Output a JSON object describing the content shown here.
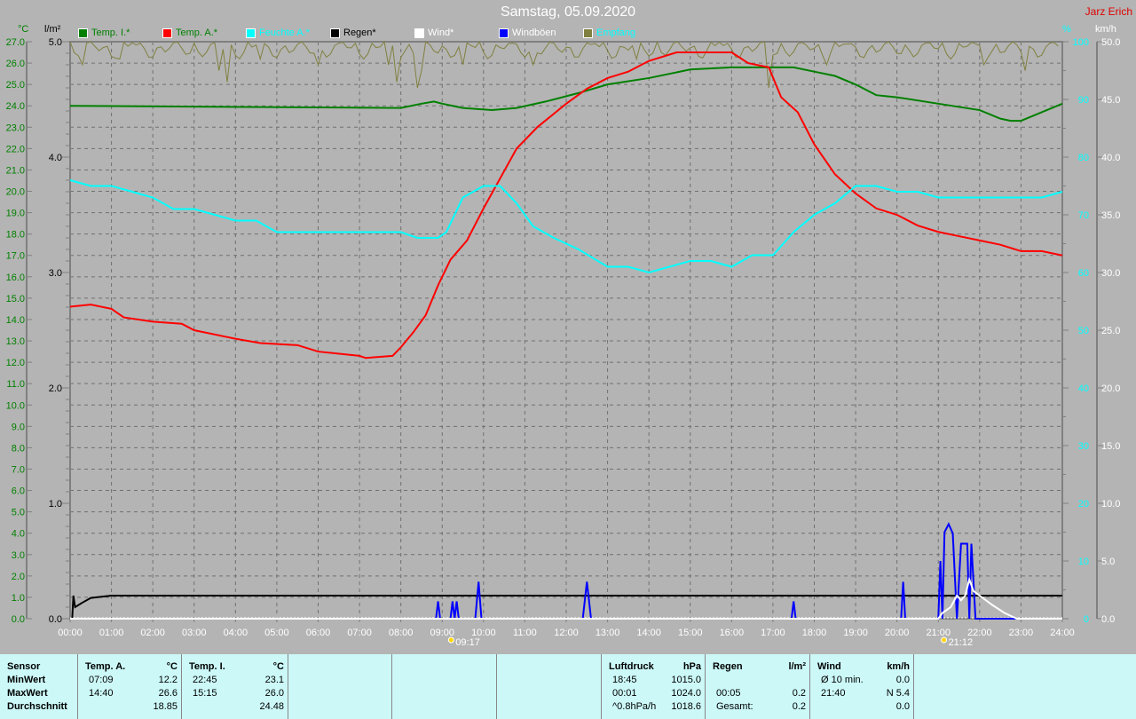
{
  "title": "Samstag, 05.09.2020",
  "author": "Jarz Erich",
  "units": {
    "temp": "°C",
    "rain": "l/m²",
    "hum": "%",
    "wind": "km/h"
  },
  "legend": [
    {
      "label": "Temp. I.*",
      "color": "#008000",
      "text_color": "#008000"
    },
    {
      "label": "Temp. A.*",
      "color": "#ff0000",
      "text_color": "#008000"
    },
    {
      "label": "Feuchte A.*",
      "color": "#00ffff",
      "text_color": "#00ffff"
    },
    {
      "label": "Regen*",
      "color": "#000000",
      "text_color": "#000000"
    },
    {
      "label": "Wind*",
      "color": "#ffffff",
      "text_color": "#ffffff"
    },
    {
      "label": "Windböen",
      "color": "#0000ff",
      "text_color": "#ffffff"
    },
    {
      "label": "Empfang",
      "color": "#808040",
      "text_color": "#00ffff"
    }
  ],
  "chart_data": {
    "type": "line",
    "title": "Samstag, 05.09.2020",
    "x_ticks": [
      "00:00",
      "01:00",
      "02:00",
      "03:00",
      "04:00",
      "05:00",
      "06:00",
      "07:00",
      "08:00",
      "09:00",
      "10:00",
      "11:00",
      "12:00",
      "13:00",
      "14:00",
      "15:00",
      "16:00",
      "17:00",
      "18:00",
      "19:00",
      "20:00",
      "21:00",
      "22:00",
      "23:00",
      "24:00"
    ],
    "xlim": [
      0,
      24
    ],
    "axes": {
      "temp": [
        0,
        27
      ],
      "rain": [
        0,
        5
      ],
      "hum": [
        0,
        100
      ],
      "wind": [
        0,
        50
      ]
    },
    "markers": [
      {
        "time": 9.28,
        "label": "09:17"
      },
      {
        "time": 21.2,
        "label": "21:12"
      }
    ],
    "series": [
      {
        "name": "Temp. I.*",
        "axis": "temp",
        "color": "#008000",
        "points": [
          [
            0,
            24.0
          ],
          [
            8,
            23.9
          ],
          [
            8.5,
            24.1
          ],
          [
            8.8,
            24.2
          ],
          [
            9,
            24.1
          ],
          [
            9.5,
            23.9
          ],
          [
            10.2,
            23.8
          ],
          [
            10.8,
            23.9
          ],
          [
            11.5,
            24.2
          ],
          [
            12.3,
            24.6
          ],
          [
            13,
            25.0
          ],
          [
            14,
            25.3
          ],
          [
            15,
            25.7
          ],
          [
            16,
            25.8
          ],
          [
            17,
            25.8
          ],
          [
            17.5,
            25.8
          ],
          [
            18,
            25.6
          ],
          [
            18.5,
            25.4
          ],
          [
            19,
            25.0
          ],
          [
            19.5,
            24.5
          ],
          [
            20,
            24.4
          ],
          [
            21,
            24.1
          ],
          [
            22,
            23.8
          ],
          [
            22.5,
            23.4
          ],
          [
            22.75,
            23.3
          ],
          [
            23,
            23.3
          ],
          [
            23.5,
            23.7
          ],
          [
            24,
            24.1
          ]
        ]
      },
      {
        "name": "Temp. A.*",
        "axis": "temp",
        "color": "#ff0000",
        "points": [
          [
            0,
            14.6
          ],
          [
            0.5,
            14.7
          ],
          [
            1,
            14.5
          ],
          [
            1.3,
            14.1
          ],
          [
            2,
            13.9
          ],
          [
            2.7,
            13.8
          ],
          [
            3,
            13.5
          ],
          [
            4,
            13.1
          ],
          [
            4.6,
            12.9
          ],
          [
            5.5,
            12.8
          ],
          [
            6,
            12.5
          ],
          [
            7,
            12.3
          ],
          [
            7.15,
            12.2
          ],
          [
            7.8,
            12.3
          ],
          [
            8,
            12.7
          ],
          [
            8.3,
            13.4
          ],
          [
            8.6,
            14.2
          ],
          [
            8.9,
            15.6
          ],
          [
            9.2,
            16.8
          ],
          [
            9.6,
            17.7
          ],
          [
            10,
            19.2
          ],
          [
            10.4,
            20.6
          ],
          [
            10.8,
            22.0
          ],
          [
            11.3,
            23.0
          ],
          [
            12,
            24.1
          ],
          [
            12.5,
            24.8
          ],
          [
            13,
            25.3
          ],
          [
            13.5,
            25.6
          ],
          [
            14,
            26.1
          ],
          [
            14.67,
            26.5
          ],
          [
            15.5,
            26.5
          ],
          [
            16,
            26.5
          ],
          [
            16.4,
            26.0
          ],
          [
            16.9,
            25.8
          ],
          [
            17.2,
            24.4
          ],
          [
            17.6,
            23.7
          ],
          [
            18,
            22.2
          ],
          [
            18.5,
            20.8
          ],
          [
            19,
            19.9
          ],
          [
            19.5,
            19.2
          ],
          [
            20,
            18.9
          ],
          [
            20.5,
            18.4
          ],
          [
            21,
            18.1
          ],
          [
            21.5,
            17.9
          ],
          [
            22,
            17.7
          ],
          [
            22.5,
            17.5
          ],
          [
            23,
            17.2
          ],
          [
            23.5,
            17.2
          ],
          [
            24,
            17.0
          ]
        ]
      },
      {
        "name": "Feuchte A.*",
        "axis": "hum",
        "color": "#00ffff",
        "points": [
          [
            0,
            76
          ],
          [
            0.5,
            75
          ],
          [
            1,
            75
          ],
          [
            1.5,
            74
          ],
          [
            2,
            73
          ],
          [
            2.5,
            71
          ],
          [
            3,
            71
          ],
          [
            3.5,
            70
          ],
          [
            4,
            69
          ],
          [
            4.5,
            69
          ],
          [
            5,
            67
          ],
          [
            6,
            67
          ],
          [
            7,
            67
          ],
          [
            8,
            67
          ],
          [
            8.4,
            66
          ],
          [
            8.9,
            66
          ],
          [
            9.1,
            67
          ],
          [
            9.5,
            73
          ],
          [
            10,
            75
          ],
          [
            10.4,
            75
          ],
          [
            10.8,
            72
          ],
          [
            11.2,
            68
          ],
          [
            11.7,
            66
          ],
          [
            12.3,
            64
          ],
          [
            13,
            61
          ],
          [
            13.5,
            61
          ],
          [
            14,
            60
          ],
          [
            14.5,
            61
          ],
          [
            15,
            62
          ],
          [
            15.5,
            62
          ],
          [
            16,
            61
          ],
          [
            16.5,
            63
          ],
          [
            17,
            63
          ],
          [
            17.5,
            67
          ],
          [
            18,
            70
          ],
          [
            18.5,
            72
          ],
          [
            19,
            75
          ],
          [
            19.5,
            75
          ],
          [
            20,
            74
          ],
          [
            20.5,
            74
          ],
          [
            21,
            73
          ],
          [
            21.5,
            73
          ],
          [
            22,
            73
          ],
          [
            23,
            73
          ],
          [
            23.5,
            73
          ],
          [
            24,
            74
          ]
        ]
      },
      {
        "name": "Regen*",
        "axis": "rain",
        "color": "#000000",
        "points": [
          [
            0,
            0
          ],
          [
            0.05,
            0
          ],
          [
            0.08,
            0.2
          ],
          [
            0.12,
            0.1
          ],
          [
            0.3,
            0.14
          ],
          [
            0.5,
            0.18
          ],
          [
            1,
            0.2
          ],
          [
            24,
            0.2
          ]
        ]
      },
      {
        "name": "Windböen",
        "axis": "wind",
        "color": "#0000ff",
        "points": [
          [
            0,
            0
          ],
          [
            8.85,
            0
          ],
          [
            8.9,
            1.5
          ],
          [
            8.95,
            0
          ],
          [
            9.2,
            0
          ],
          [
            9.25,
            1.5
          ],
          [
            9.3,
            0
          ],
          [
            9.35,
            1.5
          ],
          [
            9.4,
            0
          ],
          [
            9.8,
            0
          ],
          [
            9.88,
            3.2
          ],
          [
            9.95,
            0
          ],
          [
            12.4,
            0
          ],
          [
            12.5,
            3.2
          ],
          [
            12.6,
            0
          ],
          [
            17.45,
            0
          ],
          [
            17.5,
            1.5
          ],
          [
            17.55,
            0
          ],
          [
            20.1,
            0
          ],
          [
            20.15,
            3.2
          ],
          [
            20.2,
            0
          ],
          [
            21.0,
            0
          ],
          [
            21.05,
            5
          ],
          [
            21.1,
            0
          ],
          [
            21.15,
            7.5
          ],
          [
            21.25,
            8.2
          ],
          [
            21.35,
            7.4
          ],
          [
            21.45,
            0
          ],
          [
            21.55,
            6.5
          ],
          [
            21.7,
            6.5
          ],
          [
            21.75,
            0
          ],
          [
            21.8,
            6.5
          ],
          [
            21.9,
            0
          ],
          [
            24,
            0
          ]
        ]
      },
      {
        "name": "Wind*",
        "axis": "wind",
        "color": "#ffffff",
        "points": [
          [
            0,
            0
          ],
          [
            21.0,
            0
          ],
          [
            21.1,
            0.5
          ],
          [
            21.3,
            1.0
          ],
          [
            21.45,
            2.0
          ],
          [
            21.55,
            1.6
          ],
          [
            21.65,
            2.0
          ],
          [
            21.75,
            3.4
          ],
          [
            21.85,
            2.4
          ],
          [
            22.0,
            2.0
          ],
          [
            22.3,
            1.2
          ],
          [
            22.6,
            0.5
          ],
          [
            22.9,
            0
          ],
          [
            24,
            0
          ]
        ]
      }
    ],
    "empfang": {
      "name": "Empfang",
      "axis": "hum",
      "color": "#808040",
      "baseline": 100,
      "dips": [
        [
          0.3,
          96
        ],
        [
          1.2,
          97
        ],
        [
          3.6,
          95
        ],
        [
          3.85,
          93
        ],
        [
          4.6,
          97
        ],
        [
          6,
          96
        ],
        [
          7.7,
          96
        ],
        [
          7.85,
          93
        ],
        [
          8.4,
          92
        ],
        [
          8.5,
          95
        ],
        [
          9.5,
          96
        ],
        [
          11.2,
          96
        ],
        [
          13.7,
          97
        ],
        [
          16.9,
          92
        ],
        [
          18.3,
          96
        ],
        [
          22.1,
          96
        ],
        [
          23.1,
          95
        ]
      ]
    }
  },
  "table": {
    "sensor": {
      "header": "Sensor",
      "rows": [
        "MinWert",
        "MaxWert",
        "Durchschnitt"
      ]
    },
    "temp_a": {
      "header": "Temp. A.",
      "unit": "°C",
      "rows": [
        [
          "07:09",
          "12.2"
        ],
        [
          "14:40",
          "26.6"
        ],
        [
          "",
          "18.85"
        ]
      ]
    },
    "temp_i": {
      "header": "Temp. I.",
      "unit": "°C",
      "rows": [
        [
          "22:45",
          "23.1"
        ],
        [
          "15:15",
          "26.0"
        ],
        [
          "",
          "24.48"
        ]
      ]
    },
    "luftdruck": {
      "header": "Luftdruck",
      "unit": "hPa",
      "rows": [
        [
          "18:45",
          "1015.0"
        ],
        [
          "00:01",
          "1024.0"
        ],
        [
          "^0.8hPa/h",
          "1018.6"
        ]
      ]
    },
    "regen": {
      "header": "Regen",
      "unit": "l/m²",
      "rows": [
        [
          "",
          ""
        ],
        [
          "00:05",
          "0.2"
        ],
        [
          "Gesamt:",
          "0.2"
        ]
      ]
    },
    "wind": {
      "header": "Wind",
      "unit": "km/h",
      "rows": [
        [
          "Ø 10 min.",
          "0.0"
        ],
        [
          "21:40",
          "N 5.4"
        ],
        [
          "",
          "0.0"
        ]
      ]
    }
  }
}
